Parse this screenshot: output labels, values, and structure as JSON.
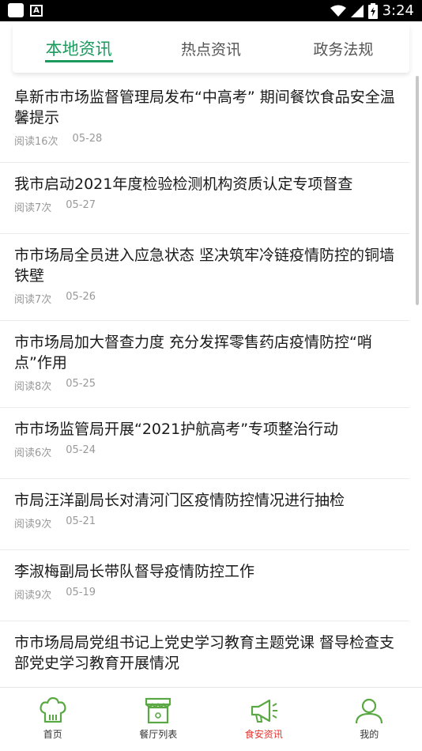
{
  "status_bar": {
    "time": "3:24"
  },
  "tabs": [
    {
      "label": "本地资讯",
      "active": true
    },
    {
      "label": "热点资讯",
      "active": false
    },
    {
      "label": "政务法规",
      "active": false
    }
  ],
  "articles": [
    {
      "title": "阜新市市场监督管理局发布“中高考” 期间餐饮食品安全温馨提示",
      "reads": "阅读16次",
      "date": "05-28"
    },
    {
      "title": "我市启动2021年度检验检测机构资质认定专项督查",
      "reads": "阅读7次",
      "date": "05-27"
    },
    {
      "title": "市市场局全员进入应急状态 坚决筑牢冷链疫情防控的铜墙铁壁",
      "reads": "阅读7次",
      "date": "05-26"
    },
    {
      "title": "市市场局加大督查力度 充分发挥零售药店疫情防控“哨点”作用",
      "reads": "阅读8次",
      "date": "05-25"
    },
    {
      "title": "市市场监管局开展“2021护航高考”专项整治行动",
      "reads": "阅读6次",
      "date": "05-24"
    },
    {
      "title": "市局汪洋副局长对清河门区疫情防控情况进行抽检",
      "reads": "阅读9次",
      "date": "05-21"
    },
    {
      "title": "李淑梅副局长带队督导疫情防控工作",
      "reads": "阅读9次",
      "date": "05-19"
    },
    {
      "title": "市市场局局党组书记上党史学习教育主题党课 督导检查支部党史学习教育开展情况",
      "reads": "",
      "date": ""
    }
  ],
  "bottom_nav": [
    {
      "label": "首页",
      "icon": "chef-hat-icon",
      "active": false
    },
    {
      "label": "餐厅列表",
      "icon": "restaurant-icon",
      "active": false
    },
    {
      "label": "食安资讯",
      "icon": "megaphone-icon",
      "active": true
    },
    {
      "label": "我的",
      "icon": "user-icon",
      "active": false
    }
  ],
  "colors": {
    "accent": "#1c9a5e",
    "active_nav": "#e5322d"
  }
}
